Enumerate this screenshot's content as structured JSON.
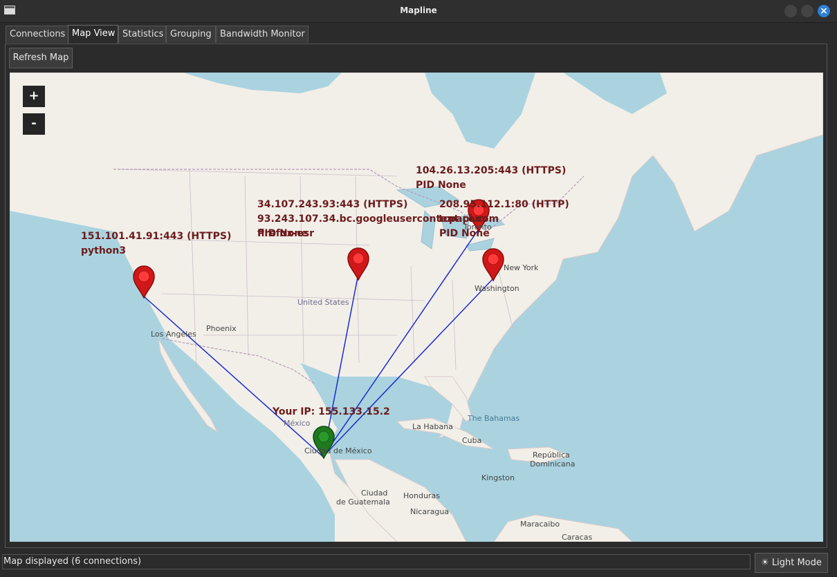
{
  "window": {
    "title": "Mapline"
  },
  "tabs": [
    {
      "label": "Connections"
    },
    {
      "label": "Map View"
    },
    {
      "label": "Statistics"
    },
    {
      "label": "Grouping"
    },
    {
      "label": "Bandwidth Monitor"
    }
  ],
  "active_tab": "Map View",
  "toolbar": {
    "refresh_label": "Refresh Map"
  },
  "map": {
    "zoom_in": "+",
    "zoom_out": "-",
    "local_marker": {
      "label": "Your IP: 155.133.15.2",
      "color": "#1f7a1f"
    },
    "remote_marker_color": "#d01818",
    "line_color": "#1a2bd0",
    "popups": [
      {
        "line1": "151.101.41.91:443 (HTTPS)",
        "line2": "python3"
      },
      {
        "line1": "34.107.243.93:443 (HTTPS)",
        "line2": "93.243.107.34.bc.googleusercontent.com",
        "line3": "PID None",
        "line4": "firefox-esr",
        "line5": "tcpapi.com"
      },
      {
        "line1": "104.26.13.205:443 (HTTPS)",
        "line2": "PID None"
      },
      {
        "line1": "208.95.112.1:80 (HTTP)",
        "line2": "PID None"
      }
    ],
    "places": {
      "los_angeles": "Los Angeles",
      "phoenix": "Phoenix",
      "united_states": "United States",
      "toronto": "Toronto",
      "new_york": "New York",
      "washington": "Washington",
      "mexico": "México",
      "ciudad_mexico": "Ciudad de México",
      "la_habana": "La Habana",
      "bahamas": "The Bahamas",
      "cuba": "Cuba",
      "republica": "República",
      "dominicana": "Dominicana",
      "kingston": "Kingston",
      "ciudad": "Ciudad",
      "guatemala": "de Guatemala",
      "honduras": "Honduras",
      "nicaragua": "Nicaragua",
      "maracaibo": "Maracaibo",
      "caracas": "Caracas"
    }
  },
  "status": {
    "text": "Map displayed (6 connections)"
  },
  "mode_button": {
    "label": "☀ Light Mode"
  }
}
